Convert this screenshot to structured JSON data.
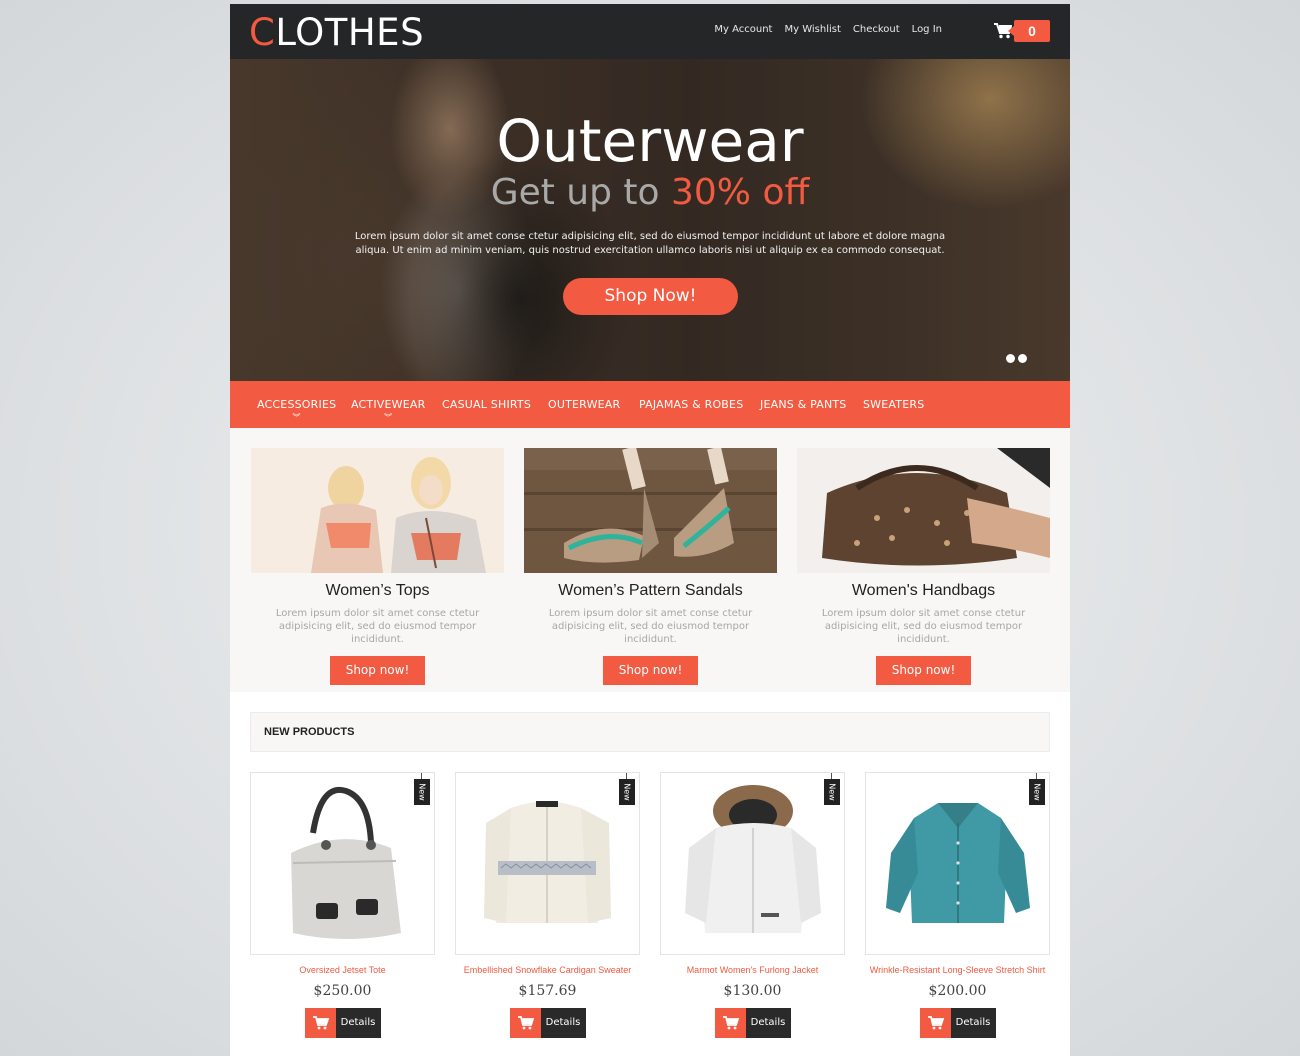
{
  "header": {
    "logo_first": "C",
    "logo_rest": "LOTHES",
    "links": [
      "My Account",
      "My Wishlist",
      "Checkout",
      "Log In"
    ],
    "cart_count": "0",
    "cart_icon": "shopping-cart-icon"
  },
  "hero": {
    "title": "Outerwear",
    "sub_prefix": "Get up to ",
    "sub_accent": "30% off",
    "text": "Lorem ipsum dolor sit amet conse ctetur adipisicing elit, sed do eiusmod tempor incididunt ut labore et dolore magna aliqua. Ut enim ad minim veniam, quis nostrud exercitation ullamco laboris nisi ut aliquip ex ea commodo consequat.",
    "button": "Shop Now!",
    "slides": 2
  },
  "nav": {
    "items": [
      "ACCESSORIES",
      "ACTIVEWEAR",
      "CASUAL SHIRTS",
      "OUTERWEAR",
      "PAJAMAS & ROBES",
      "JEANS & PANTS",
      "SWEATERS"
    ],
    "dropdown_icon": "double-chevron-down-icon"
  },
  "promos": [
    {
      "title": "Women’s Tops",
      "text": "Lorem ipsum dolor sit amet conse ctetur adipisicing elit, sed do eiusmod tempor incididunt.",
      "button": "Shop now!"
    },
    {
      "title": "Women’s Pattern Sandals",
      "text": "Lorem ipsum dolor sit amet conse ctetur adipisicing elit, sed do eiusmod tempor incididunt.",
      "button": "Shop now!"
    },
    {
      "title": "Women's Handbags",
      "text": "Lorem ipsum dolor sit amet conse ctetur adipisicing elit, sed do eiusmod tempor incididunt.",
      "button": "Shop now!"
    }
  ],
  "new_products": {
    "heading": "NEW PRODUCTS",
    "items": [
      {
        "tag": "New",
        "name": "Oversized Jetset Tote",
        "price": "$250.00",
        "details": "Details"
      },
      {
        "tag": "New",
        "name": "Embellished Snowflake Cardigan Sweater",
        "price": "$157.69",
        "details": "Details"
      },
      {
        "tag": "New",
        "name": "Marmot Women's Furlong Jacket",
        "price": "$130.00",
        "details": "Details"
      },
      {
        "tag": "New",
        "name": "Wrinkle-Resistant Long-Sleeve Stretch Shirt",
        "price": "$200.00",
        "details": "Details"
      }
    ]
  },
  "colors": {
    "accent": "#f25a41",
    "header_bg": "#252627",
    "promo_bg": "#f8f7f5"
  }
}
